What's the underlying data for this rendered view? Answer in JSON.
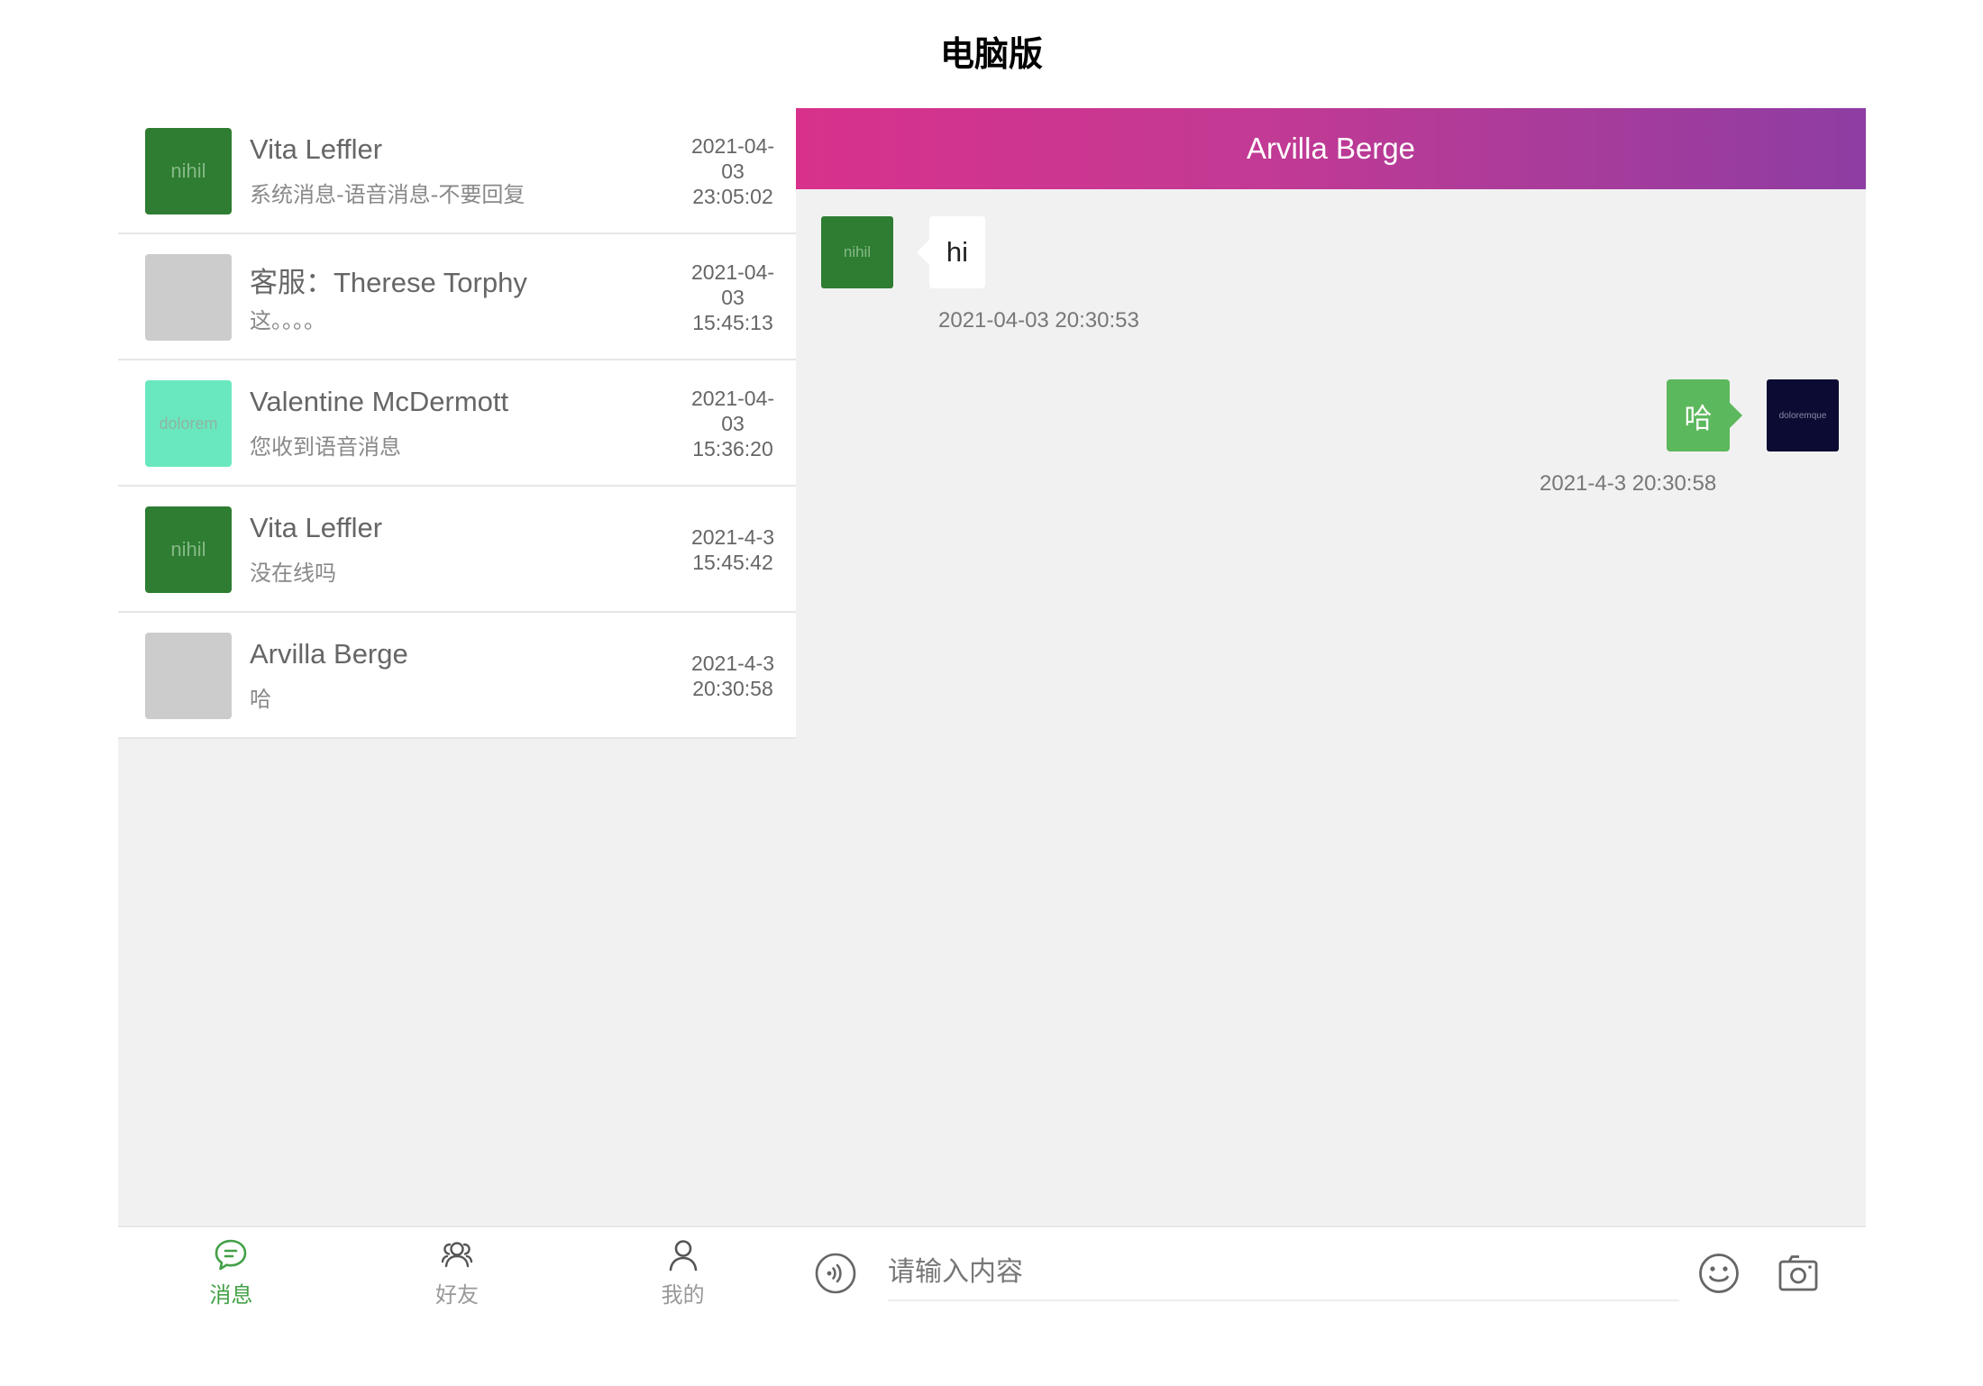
{
  "page": {
    "title": "电脑版"
  },
  "conversations": [
    {
      "name": "Vita Leffler",
      "preview": "系统消息-语音消息-不要回复",
      "time": "2021-04-\n03\n23:05:02",
      "avatar_text": "nihil",
      "avatar_color": "#2e7d32",
      "avatar_text_color": "#86b986"
    },
    {
      "name": "客服：Therese Torphy",
      "preview": "这。。。。",
      "time": "2021-04-\n03\n15:45:13",
      "avatar_text": "",
      "avatar_color": "#cccccc",
      "avatar_text_color": "#cccccc"
    },
    {
      "name": "Valentine McDermott",
      "preview": "您收到语音消息",
      "time": "2021-04-\n03\n15:36:20",
      "avatar_text": "dolorem",
      "avatar_color": "#69e8c0",
      "avatar_text_color": "#9ab8a8"
    },
    {
      "name": "Vita Leffler",
      "preview": "没在线吗",
      "time": "2021-4-3\n15:45:42",
      "avatar_text": "nihil",
      "avatar_color": "#2e7d32",
      "avatar_text_color": "#86b986"
    },
    {
      "name": "Arvilla Berge",
      "preview": "哈",
      "time": "2021-4-3\n20:30:58",
      "avatar_text": "",
      "avatar_color": "#cccccc",
      "avatar_text_color": "#cccccc"
    }
  ],
  "nav": {
    "tabs": [
      {
        "label": "消息",
        "icon": "chat-bubble-icon",
        "active": true
      },
      {
        "label": "好友",
        "icon": "friends-icon",
        "active": false
      },
      {
        "label": "我的",
        "icon": "user-icon",
        "active": false
      }
    ],
    "active_color": "#43a047",
    "inactive_color": "#999999"
  },
  "chat": {
    "title": "Arvilla Berge",
    "messages": [
      {
        "direction": "in",
        "text": "hi",
        "time": "2021-04-03 20:30:53",
        "avatar_text": "nihil",
        "avatar_color": "#2e7d32"
      },
      {
        "direction": "out",
        "text": "哈",
        "time": "2021-4-3 20:30:58",
        "avatar_text": "doloremque",
        "avatar_color": "#0b0b33"
      }
    ],
    "input_placeholder": "请输入内容"
  },
  "colors": {
    "header_gradient": [
      "#d8318c",
      "#8e3da3"
    ],
    "outgoing_bubble": "#5cb85c",
    "panel_background": "#f1f1f1"
  }
}
